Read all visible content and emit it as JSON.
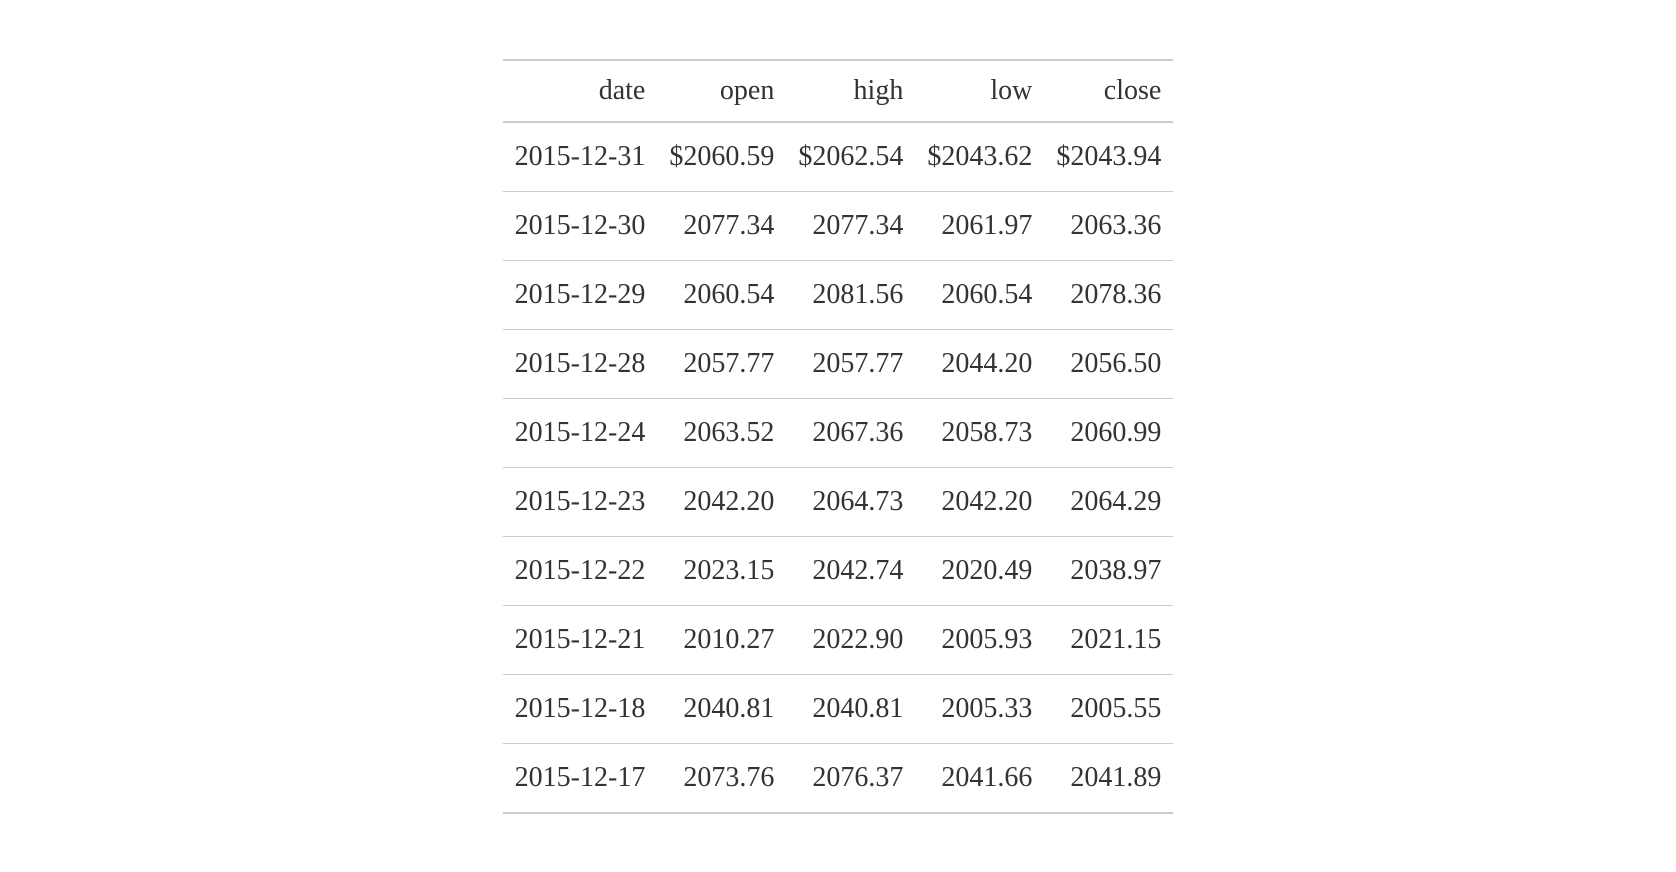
{
  "chart_data": {
    "type": "table",
    "columns": [
      "date",
      "open",
      "high",
      "low",
      "close"
    ],
    "rows": [
      {
        "date": "2015-12-31",
        "open": "$2060.59",
        "high": "$2062.54",
        "low": "$2043.62",
        "close": "$2043.94"
      },
      {
        "date": "2015-12-30",
        "open": "2077.34",
        "high": "2077.34",
        "low": "2061.97",
        "close": "2063.36"
      },
      {
        "date": "2015-12-29",
        "open": "2060.54",
        "high": "2081.56",
        "low": "2060.54",
        "close": "2078.36"
      },
      {
        "date": "2015-12-28",
        "open": "2057.77",
        "high": "2057.77",
        "low": "2044.20",
        "close": "2056.50"
      },
      {
        "date": "2015-12-24",
        "open": "2063.52",
        "high": "2067.36",
        "low": "2058.73",
        "close": "2060.99"
      },
      {
        "date": "2015-12-23",
        "open": "2042.20",
        "high": "2064.73",
        "low": "2042.20",
        "close": "2064.29"
      },
      {
        "date": "2015-12-22",
        "open": "2023.15",
        "high": "2042.74",
        "low": "2020.49",
        "close": "2038.97"
      },
      {
        "date": "2015-12-21",
        "open": "2010.27",
        "high": "2022.90",
        "low": "2005.93",
        "close": "2021.15"
      },
      {
        "date": "2015-12-18",
        "open": "2040.81",
        "high": "2040.81",
        "low": "2005.33",
        "close": "2005.55"
      },
      {
        "date": "2015-12-17",
        "open": "2073.76",
        "high": "2076.37",
        "low": "2041.66",
        "close": "2041.89"
      }
    ]
  }
}
